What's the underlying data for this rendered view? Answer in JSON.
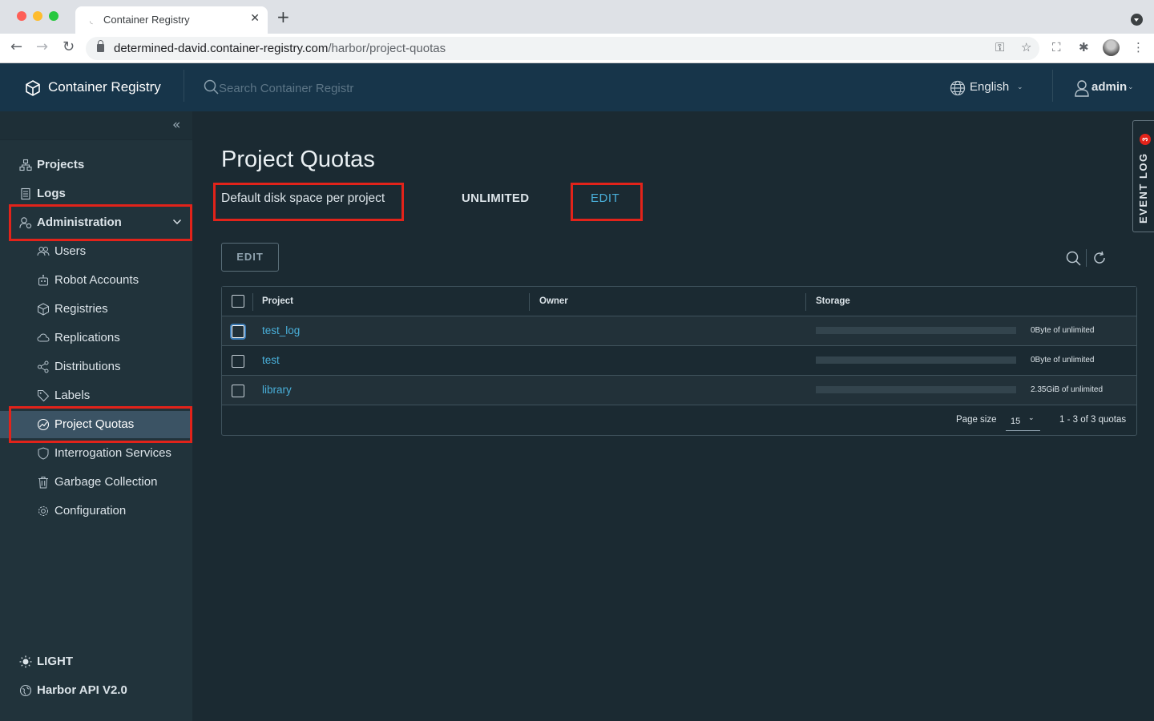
{
  "browser": {
    "tab_title": "Container Registry",
    "url_host": "determined-david.container-registry.com",
    "url_path": "/harbor/project-quotas"
  },
  "header": {
    "brand": "Container Registry",
    "search_placeholder": "Search Container Registr",
    "language": "English",
    "user": "admin"
  },
  "sidebar": {
    "items": [
      {
        "label": "Projects",
        "icon": "projects-icon"
      },
      {
        "label": "Logs",
        "icon": "logs-icon"
      },
      {
        "label": "Administration",
        "icon": "administration-icon",
        "expanded": true
      }
    ],
    "admin_items": [
      {
        "label": "Users",
        "icon": "users-icon"
      },
      {
        "label": "Robot Accounts",
        "icon": "robot-icon"
      },
      {
        "label": "Registries",
        "icon": "registries-icon"
      },
      {
        "label": "Replications",
        "icon": "replications-icon"
      },
      {
        "label": "Distributions",
        "icon": "distributions-icon"
      },
      {
        "label": "Labels",
        "icon": "labels-icon"
      },
      {
        "label": "Project Quotas",
        "icon": "quotas-icon",
        "active": true
      },
      {
        "label": "Interrogation Services",
        "icon": "shield-icon"
      },
      {
        "label": "Garbage Collection",
        "icon": "trash-icon"
      },
      {
        "label": "Configuration",
        "icon": "gear-icon"
      }
    ],
    "theme_toggle": "LIGHT",
    "api_link": "Harbor API V2.0"
  },
  "main": {
    "title": "Project Quotas",
    "default_quota_label": "Default disk space per project",
    "default_quota_value": "UNLIMITED",
    "default_quota_edit": "EDIT",
    "edit_button": "EDIT",
    "columns": [
      "Project",
      "Owner",
      "Storage"
    ],
    "rows": [
      {
        "project": "test_log",
        "owner": "",
        "storage": "0Byte of unlimited",
        "used_fraction": 0
      },
      {
        "project": "test",
        "owner": "",
        "storage": "0Byte of unlimited",
        "used_fraction": 0
      },
      {
        "project": "library",
        "owner": "",
        "storage": "2.35GiB of unlimited",
        "used_fraction": 0
      }
    ],
    "page_size_label": "Page size",
    "page_size": "15",
    "page_count": "1 - 3 of 3 quotas"
  },
  "event_log": {
    "label": "EVENT LOG",
    "count": "3"
  },
  "colors": {
    "header_bg": "#17354a",
    "sidebar_bg": "#21333b",
    "main_bg": "#1b2a32",
    "link": "#49afd9",
    "highlight": "#e2231a"
  }
}
